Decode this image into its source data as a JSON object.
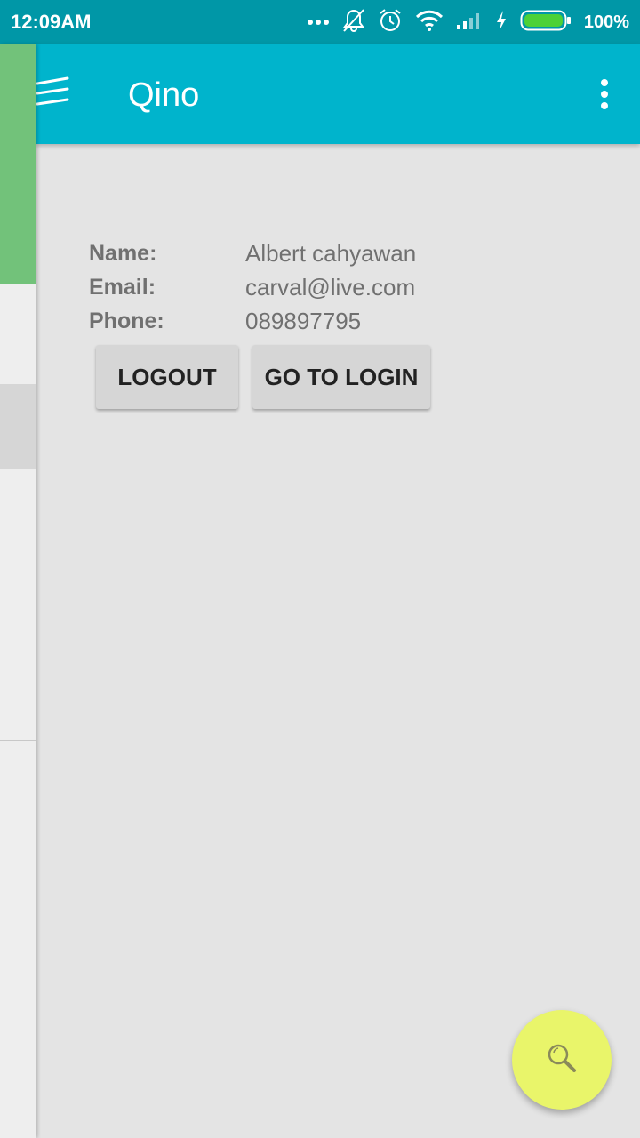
{
  "status_bar": {
    "time": "12:09AM",
    "battery_percent": "100%",
    "icons": [
      "more-dots-icon",
      "notifications-off-icon",
      "alarm-icon",
      "wifi-icon",
      "signal-icon",
      "charging-icon",
      "battery-icon"
    ]
  },
  "app_bar": {
    "title": "Qino",
    "menu_icon": "hamburger-menu-icon",
    "overflow_icon": "more-vert-icon"
  },
  "profile": {
    "name_label": "Name:",
    "name_value": "Albert cahyawan",
    "email_label": "Email:",
    "email_value": "carval@live.com",
    "phone_label": "Phone:",
    "phone_value": "089897795"
  },
  "actions": {
    "logout_label": "LOGOUT",
    "go_to_login_label": "GO TO LOGIN"
  },
  "fab": {
    "icon": "search-icon"
  },
  "colors": {
    "status_bar": "#0097a7",
    "app_bar": "#00b4cc",
    "background": "#e4e4e4",
    "drawer_accent": "#72c27a",
    "fab": "#e9f56a"
  }
}
